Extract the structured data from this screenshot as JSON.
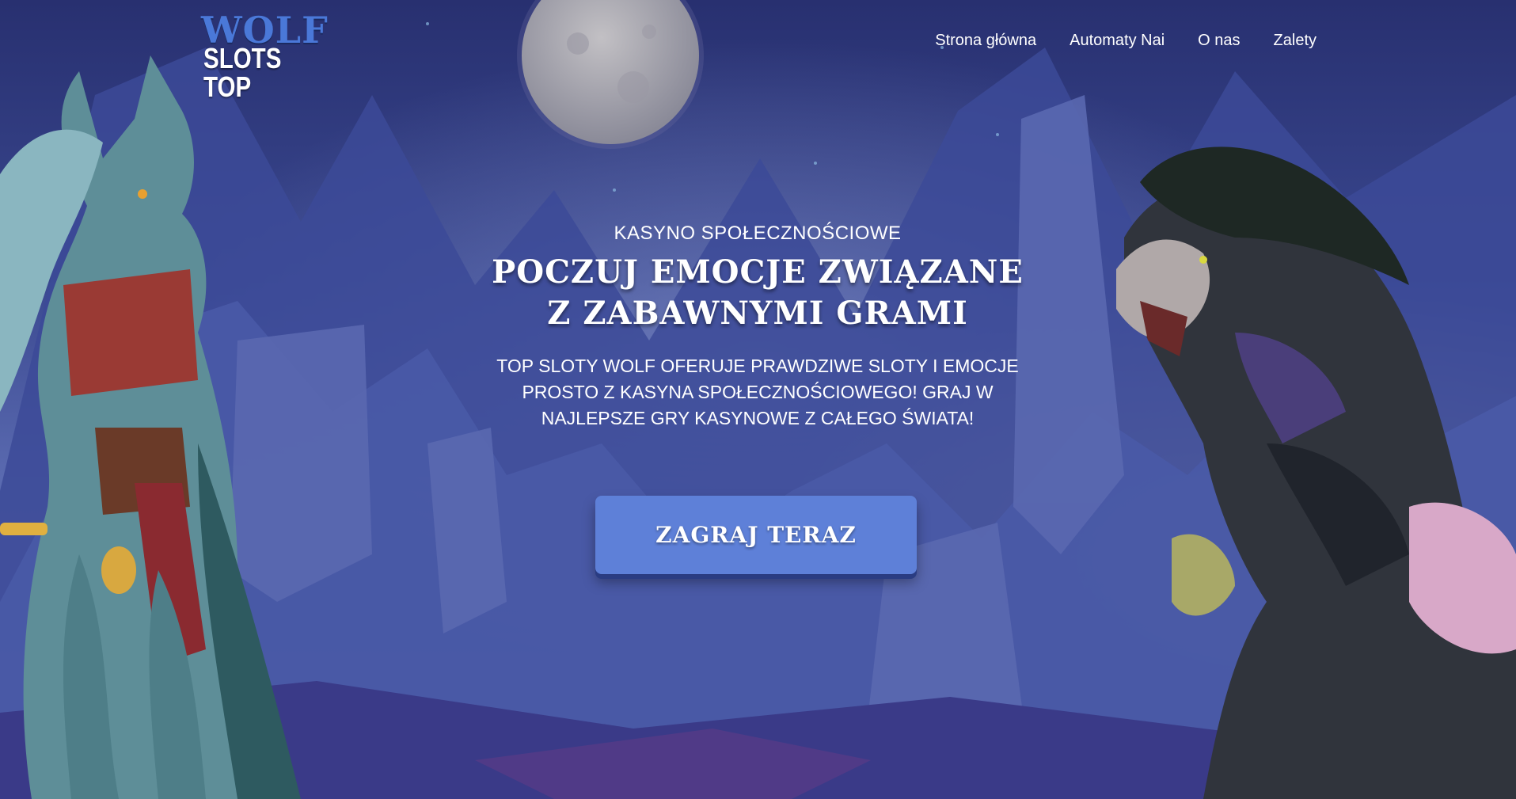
{
  "header": {
    "logo": {
      "line1": "WOLF",
      "line2": "SLOTS TOP"
    },
    "nav": [
      {
        "label": "Strona główna"
      },
      {
        "label": "Automaty Nai"
      },
      {
        "label": "O nas"
      },
      {
        "label": "Zalety"
      }
    ]
  },
  "hero": {
    "eyebrow": "KASYNO SPOŁECZNOŚCIOWE",
    "title": "POCZUJ EMOCJE ZWIĄZANE Z ZABAWNYMI GRAMI",
    "description": "TOP SLOTY WOLF OFERUJE PRAWDZIWE SLOTY I EMOCJE PROSTO Z KASYNA SPOŁECZNOŚCIOWEGO! GRAJ W NAJLEPSZE GRY KASYNOWE Z CAŁEGO ŚWIATA!",
    "cta_label": "ZAGRAJ TERAZ"
  },
  "colors": {
    "accent": "#5e80d8",
    "logo_blue": "#4a78d8",
    "sky_top": "#283070",
    "sky_bottom": "#6a78b8"
  }
}
